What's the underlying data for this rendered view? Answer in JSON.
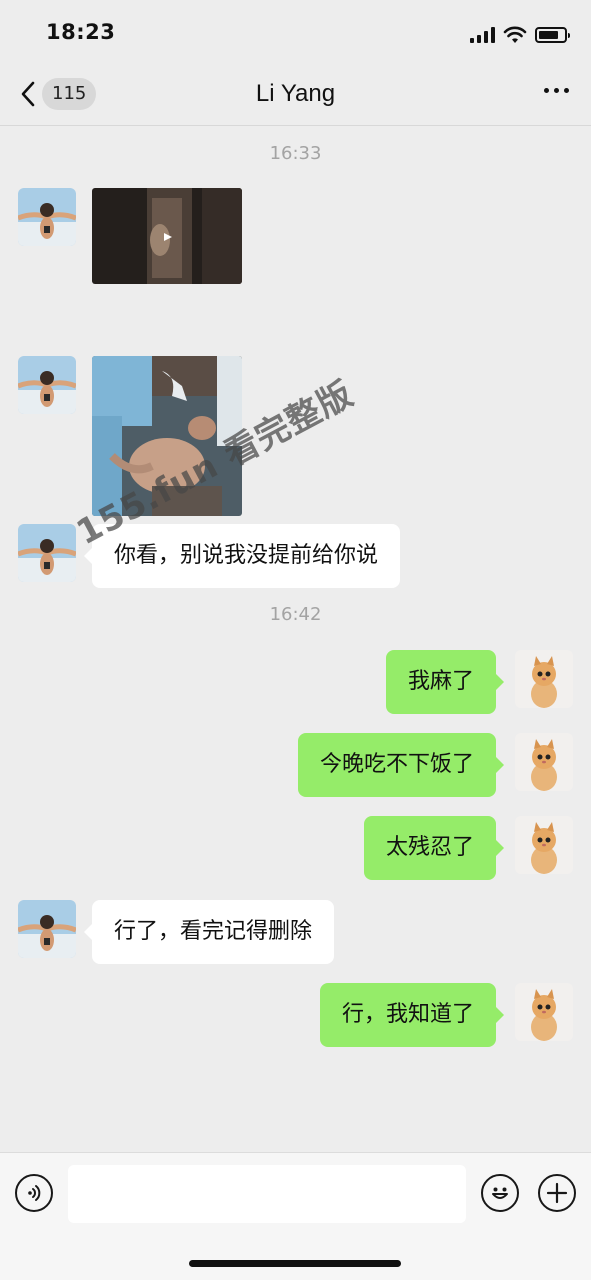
{
  "status_bar": {
    "time": "18:23"
  },
  "nav": {
    "unread_count": "115",
    "title": "Li Yang"
  },
  "timestamps": [
    "16:33",
    "16:42"
  ],
  "messages": [
    {
      "side": "in",
      "type": "video"
    },
    {
      "side": "in",
      "type": "image"
    },
    {
      "side": "in",
      "type": "text",
      "text": "你看，别说我没提前给你说"
    },
    {
      "side": "out",
      "type": "text",
      "text": "我麻了"
    },
    {
      "side": "out",
      "type": "text",
      "text": "今晚吃不下饭了"
    },
    {
      "side": "out",
      "type": "text",
      "text": "太残忍了"
    },
    {
      "side": "in",
      "type": "text",
      "text": "行了，看完记得删除"
    },
    {
      "side": "out",
      "type": "text",
      "text": "行，我知道了"
    }
  ],
  "watermark": {
    "text": "155.fun 看完整版"
  },
  "input": {
    "value": "",
    "placeholder": ""
  },
  "icons": {
    "back": "chevron-left-icon",
    "more": "more-dots-icon",
    "voice": "voice-icon",
    "emoji": "emoji-icon",
    "plus": "plus-icon"
  },
  "colors": {
    "background": "#ededed",
    "incoming_bubble": "#ffffff",
    "outgoing_bubble": "#95ec69",
    "timestamp": "#a3a3a3"
  }
}
